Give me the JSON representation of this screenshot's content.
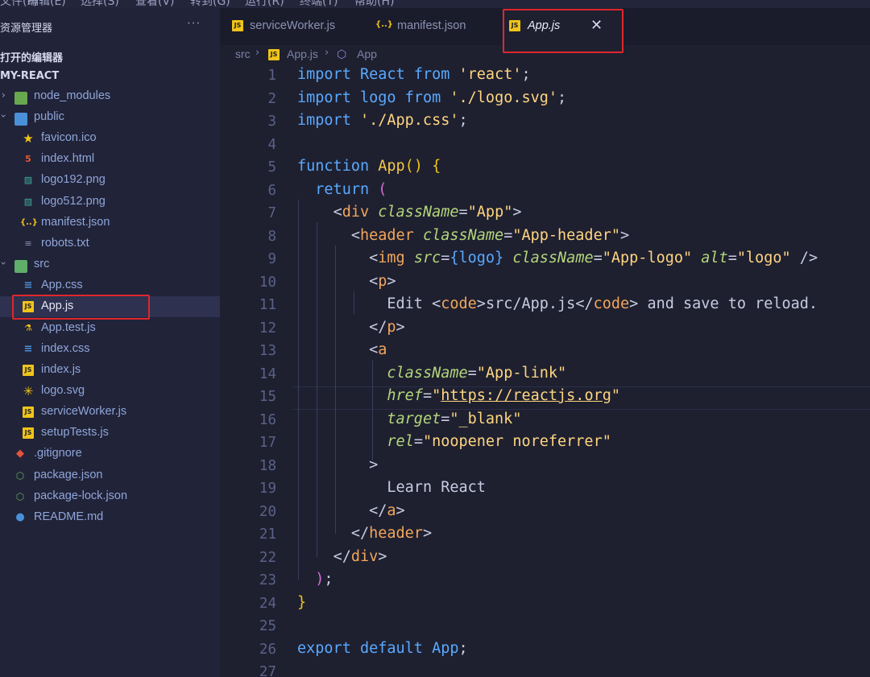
{
  "menu": [
    "文件(F)",
    "编辑(E)",
    "选择(S)",
    "查看(V)",
    "转到(G)",
    "运行(R)",
    "终端(T)",
    "帮助(H)"
  ],
  "sidebar": {
    "title": "资源管理器",
    "more": "···",
    "open_editors": "打开的编辑器",
    "project": "MY-REACT",
    "items": [
      {
        "label": "node_modules",
        "icon": "node-folder-icon"
      },
      {
        "label": "public",
        "icon": "public-folder-icon"
      },
      {
        "label": "favicon.ico",
        "icon": "star-icon"
      },
      {
        "label": "index.html",
        "icon": "html-icon"
      },
      {
        "label": "logo192.png",
        "icon": "image-icon"
      },
      {
        "label": "logo512.png",
        "icon": "image-icon"
      },
      {
        "label": "manifest.json",
        "icon": "json-icon"
      },
      {
        "label": "robots.txt",
        "icon": "text-icon"
      },
      {
        "label": "src",
        "icon": "src-folder-icon"
      },
      {
        "label": "App.css",
        "icon": "css-icon"
      },
      {
        "label": "App.js",
        "icon": "js-icon"
      },
      {
        "label": "App.test.js",
        "icon": "test-icon"
      },
      {
        "label": "index.css",
        "icon": "css-icon"
      },
      {
        "label": "index.js",
        "icon": "js-icon"
      },
      {
        "label": "logo.svg",
        "icon": "svg-icon"
      },
      {
        "label": "serviceWorker.js",
        "icon": "js-icon"
      },
      {
        "label": "setupTests.js",
        "icon": "js-icon"
      },
      {
        "label": ".gitignore",
        "icon": "git-icon"
      },
      {
        "label": "package.json",
        "icon": "npm-icon"
      },
      {
        "label": "package-lock.json",
        "icon": "npm-icon"
      },
      {
        "label": "README.md",
        "icon": "info-icon"
      }
    ]
  },
  "tabs": [
    {
      "label": "serviceWorker.js",
      "icon": "js-icon"
    },
    {
      "label": "manifest.json",
      "icon": "json-icon"
    },
    {
      "label": "App.js",
      "icon": "js-icon",
      "active": true
    }
  ],
  "icon_glyphs": {
    "js": "JS",
    "json": "{..}",
    "close": "✕",
    "chevron_right": "›"
  },
  "breadcrumb": [
    "src",
    "App.js",
    "App"
  ],
  "colors": {
    "highlight": "#e0262c",
    "accent": "#5aa9ff",
    "string": "#ffd580",
    "tag": "#f2a65a"
  },
  "line_numbers": [
    "1",
    "2",
    "3",
    "4",
    "5",
    "6",
    "7",
    "8",
    "9",
    "10",
    "11",
    "12",
    "13",
    "14",
    "15",
    "16",
    "17",
    "18",
    "19",
    "20",
    "21",
    "22",
    "23",
    "24",
    "25",
    "26",
    "27"
  ],
  "code": {
    "l1": [
      "import",
      " ",
      "React",
      " ",
      "from",
      " ",
      "'react'",
      ";"
    ],
    "l2": [
      "import",
      " ",
      "logo",
      " ",
      "from",
      " ",
      "'./logo.svg'",
      ";"
    ],
    "l3": [
      "import",
      " ",
      "'./App.css'",
      ";"
    ],
    "l5": [
      "function",
      " ",
      "App",
      "()",
      " ",
      "{"
    ],
    "l6": [
      "return",
      " ",
      "("
    ],
    "l7": [
      "<",
      "div",
      " ",
      "className",
      "=",
      "\"App\"",
      ">"
    ],
    "l8": [
      "<",
      "header",
      " ",
      "className",
      "=",
      "\"App-header\"",
      ">"
    ],
    "l9": [
      "<",
      "img",
      " ",
      "src",
      "=",
      "{",
      "logo",
      "}",
      " ",
      "className",
      "=",
      "\"App-logo\"",
      " ",
      "alt",
      "=",
      "\"logo\"",
      " />"
    ],
    "l10": [
      "<",
      "p",
      ">"
    ],
    "l11": [
      "Edit ",
      "<",
      "code",
      ">",
      "src/App.js",
      "</",
      "code",
      ">",
      " and save to reload."
    ],
    "l12": [
      "</",
      "p",
      ">"
    ],
    "l13": [
      "<",
      "a"
    ],
    "l14": [
      "className",
      "=",
      "\"App-link\""
    ],
    "l15": [
      "href",
      "=",
      "\"",
      "https://reactjs.org",
      "\""
    ],
    "l16": [
      "target",
      "=",
      "\"_blank\""
    ],
    "l17": [
      "rel",
      "=",
      "\"noopener noreferrer\""
    ],
    "l18": [
      ">"
    ],
    "l19": [
      "Learn React"
    ],
    "l20": [
      "</",
      "a",
      ">"
    ],
    "l21": [
      "</",
      "header",
      ">"
    ],
    "l22": [
      "</",
      "div",
      ">"
    ],
    "l23": [
      ")",
      ";"
    ],
    "l24": [
      "}"
    ],
    "l26": [
      "export",
      " ",
      "default",
      " ",
      "App",
      ";"
    ]
  }
}
